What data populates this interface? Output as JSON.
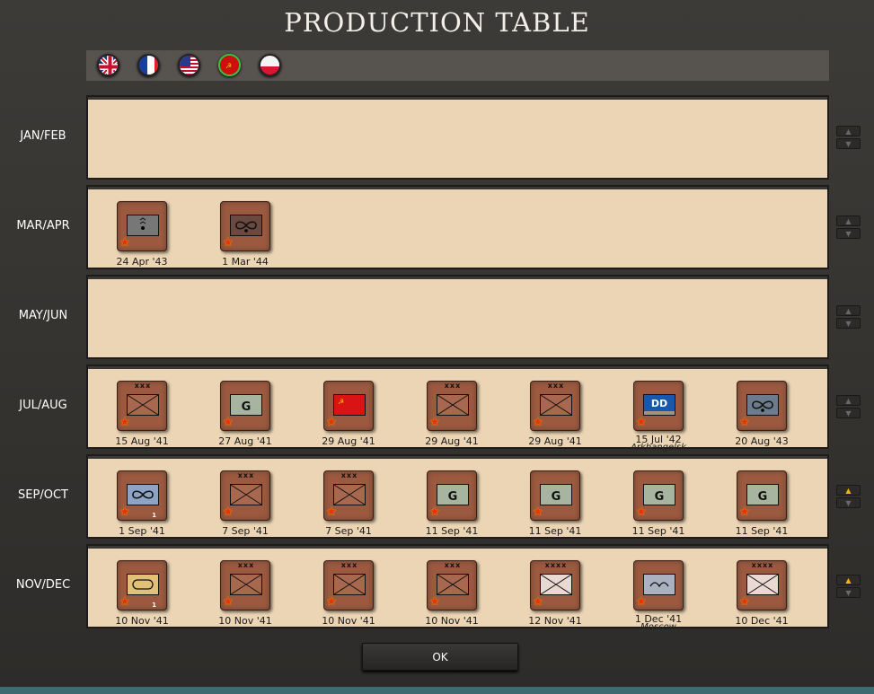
{
  "title": "PRODUCTION TABLE",
  "flags": [
    {
      "name": "uk",
      "selected": false
    },
    {
      "name": "france",
      "selected": false
    },
    {
      "name": "usa",
      "selected": false
    },
    {
      "name": "ussr",
      "selected": true
    },
    {
      "name": "poland",
      "selected": false
    }
  ],
  "ok_label": "OK",
  "colors": {
    "counter": "#9b5a40",
    "panel": "#ecd5b5",
    "accent_up": "#f0b800",
    "selected_flag": "#3cc13c"
  },
  "rows": [
    {
      "label": "JAN/FEB",
      "up_active": false,
      "units": []
    },
    {
      "label": "MAR/APR",
      "up_active": false,
      "units": [
        {
          "symbol": "hq-grey",
          "date": "24 Apr '43"
        },
        {
          "symbol": "recon-dark",
          "date": "1 Mar '44"
        }
      ]
    },
    {
      "label": "MAY/JUN",
      "up_active": false,
      "units": []
    },
    {
      "label": "JUL/AUG",
      "up_active": false,
      "units": [
        {
          "symbol": "army",
          "size": "xxx",
          "date": "15 Aug '41"
        },
        {
          "symbol": "guards",
          "text": "G",
          "date": "27 Aug '41"
        },
        {
          "symbol": "soviet-flag",
          "date": "29 Aug '41"
        },
        {
          "symbol": "army",
          "size": "xxx",
          "date": "29 Aug '41"
        },
        {
          "symbol": "army",
          "size": "xxx",
          "date": "29 Aug '41"
        },
        {
          "symbol": "destroyer",
          "text": "DD",
          "date": "15 Jul '42",
          "location": "Arkhangelsk"
        },
        {
          "symbol": "recon-slate",
          "date": "20 Aug '43"
        }
      ]
    },
    {
      "label": "SEP/OCT",
      "up_active": true,
      "units": [
        {
          "symbol": "recon-blue",
          "date": "1 Sep '41",
          "count": "1"
        },
        {
          "symbol": "army",
          "size": "xxx",
          "date": "7 Sep '41"
        },
        {
          "symbol": "army",
          "size": "xxx",
          "date": "7 Sep '41"
        },
        {
          "symbol": "guards",
          "text": "G",
          "date": "11 Sep '41"
        },
        {
          "symbol": "guards",
          "text": "G",
          "date": "11 Sep '41"
        },
        {
          "symbol": "guards",
          "text": "G",
          "date": "11 Sep '41"
        },
        {
          "symbol": "guards",
          "text": "G",
          "date": "11 Sep '41"
        }
      ]
    },
    {
      "label": "NOV/DEC",
      "up_active": true,
      "units": [
        {
          "symbol": "armor",
          "date": "10 Nov '41",
          "count": "1"
        },
        {
          "symbol": "army",
          "size": "xxx",
          "date": "10 Nov '41"
        },
        {
          "symbol": "army",
          "size": "xxx",
          "date": "10 Nov '41"
        },
        {
          "symbol": "army",
          "size": "xxx",
          "date": "10 Nov '41"
        },
        {
          "symbol": "front",
          "size": "xxxx",
          "date": "12 Nov '41"
        },
        {
          "symbol": "fortification",
          "date": "1 Dec '41",
          "location": "Moscow"
        },
        {
          "symbol": "front",
          "size": "xxxx",
          "date": "10 Dec '41"
        }
      ]
    }
  ]
}
